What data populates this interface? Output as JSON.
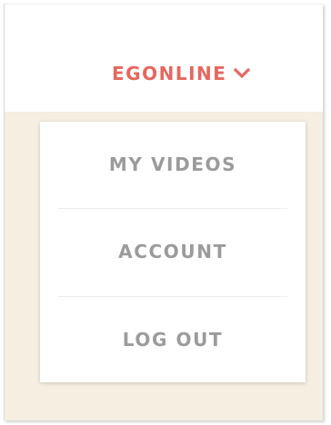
{
  "user_menu": {
    "username": "EGONLINE",
    "chevron_icon": "chevron-down-icon",
    "accent_color": "#e6675f"
  },
  "dropdown": {
    "items": [
      {
        "label": "MY VIDEOS"
      },
      {
        "label": "ACCOUNT"
      },
      {
        "label": "LOG OUT"
      }
    ],
    "text_color": "#9b9b9b",
    "background_color": "#ffffff"
  },
  "page": {
    "background_color": "#f5eee1"
  }
}
